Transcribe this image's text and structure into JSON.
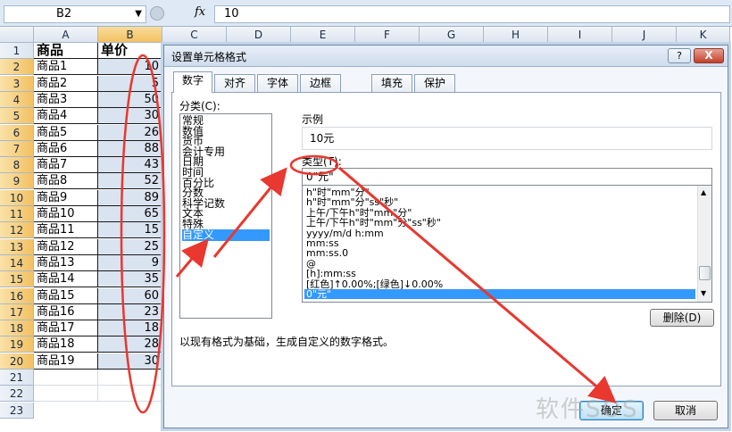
{
  "formula_bar": {
    "name_box": "B2",
    "fx": "fx",
    "value": "10"
  },
  "columns": [
    "A",
    "B",
    "C",
    "D",
    "E",
    "F",
    "G",
    "H",
    "I",
    "J",
    "K"
  ],
  "rows": [
    "1",
    "2",
    "3",
    "4",
    "5",
    "6",
    "7",
    "8",
    "9",
    "10",
    "11",
    "12",
    "13",
    "14",
    "15",
    "16",
    "17",
    "18",
    "19",
    "20",
    "21",
    "22",
    "23"
  ],
  "table": {
    "header": [
      "商品",
      "单价"
    ],
    "data": [
      [
        "商品1",
        "10"
      ],
      [
        "商品2",
        "5"
      ],
      [
        "商品3",
        "50"
      ],
      [
        "商品4",
        "30"
      ],
      [
        "商品5",
        "26"
      ],
      [
        "商品6",
        "88"
      ],
      [
        "商品7",
        "43"
      ],
      [
        "商品8",
        "52"
      ],
      [
        "商品9",
        "89"
      ],
      [
        "商品10",
        "65"
      ],
      [
        "商品11",
        "15"
      ],
      [
        "商品12",
        "25"
      ],
      [
        "商品13",
        "9"
      ],
      [
        "商品14",
        "35"
      ],
      [
        "商品15",
        "60"
      ],
      [
        "商品16",
        "23"
      ],
      [
        "商品17",
        "18"
      ],
      [
        "商品18",
        "28"
      ],
      [
        "商品19",
        "30"
      ]
    ]
  },
  "dialog": {
    "title": "设置单元格格式",
    "help": "?",
    "close": "X",
    "tabs": [
      "数字",
      "对齐",
      "字体",
      "边框",
      "填充",
      "保护"
    ],
    "category_label": "分类(C):",
    "categories": [
      "常规",
      "数值",
      "货币",
      "会计专用",
      "日期",
      "时间",
      "百分比",
      "分数",
      "科学记数",
      "文本",
      "特殊",
      "自定义"
    ],
    "selected_category": 11,
    "sample_label": "示例",
    "sample_value": "10元",
    "type_label": "类型(T):",
    "type_value": "0\"元\"",
    "formats": [
      "h\"时\"mm\"分\"",
      "h\"时\"mm\"分\"ss\"秒\"",
      "上午/下午h\"时\"mm\"分\"",
      "上午/下午h\"时\"mm\"分\"ss\"秒\"",
      "yyyy/m/d h:mm",
      "mm:ss",
      "mm:ss.0",
      "@",
      "[h]:mm:ss",
      "[红色]↑0.00%;[绿色]↓0.00%",
      "0\"元\""
    ],
    "selected_format": 10,
    "delete_button": "删除(D)",
    "hint": "以现有格式为基础，生成自定义的数字格式。",
    "ok_button": "确定",
    "cancel_button": "取消"
  },
  "watermark": "软件SOS",
  "annotation_color": "#e8382f",
  "selection_color": "#3399ff"
}
